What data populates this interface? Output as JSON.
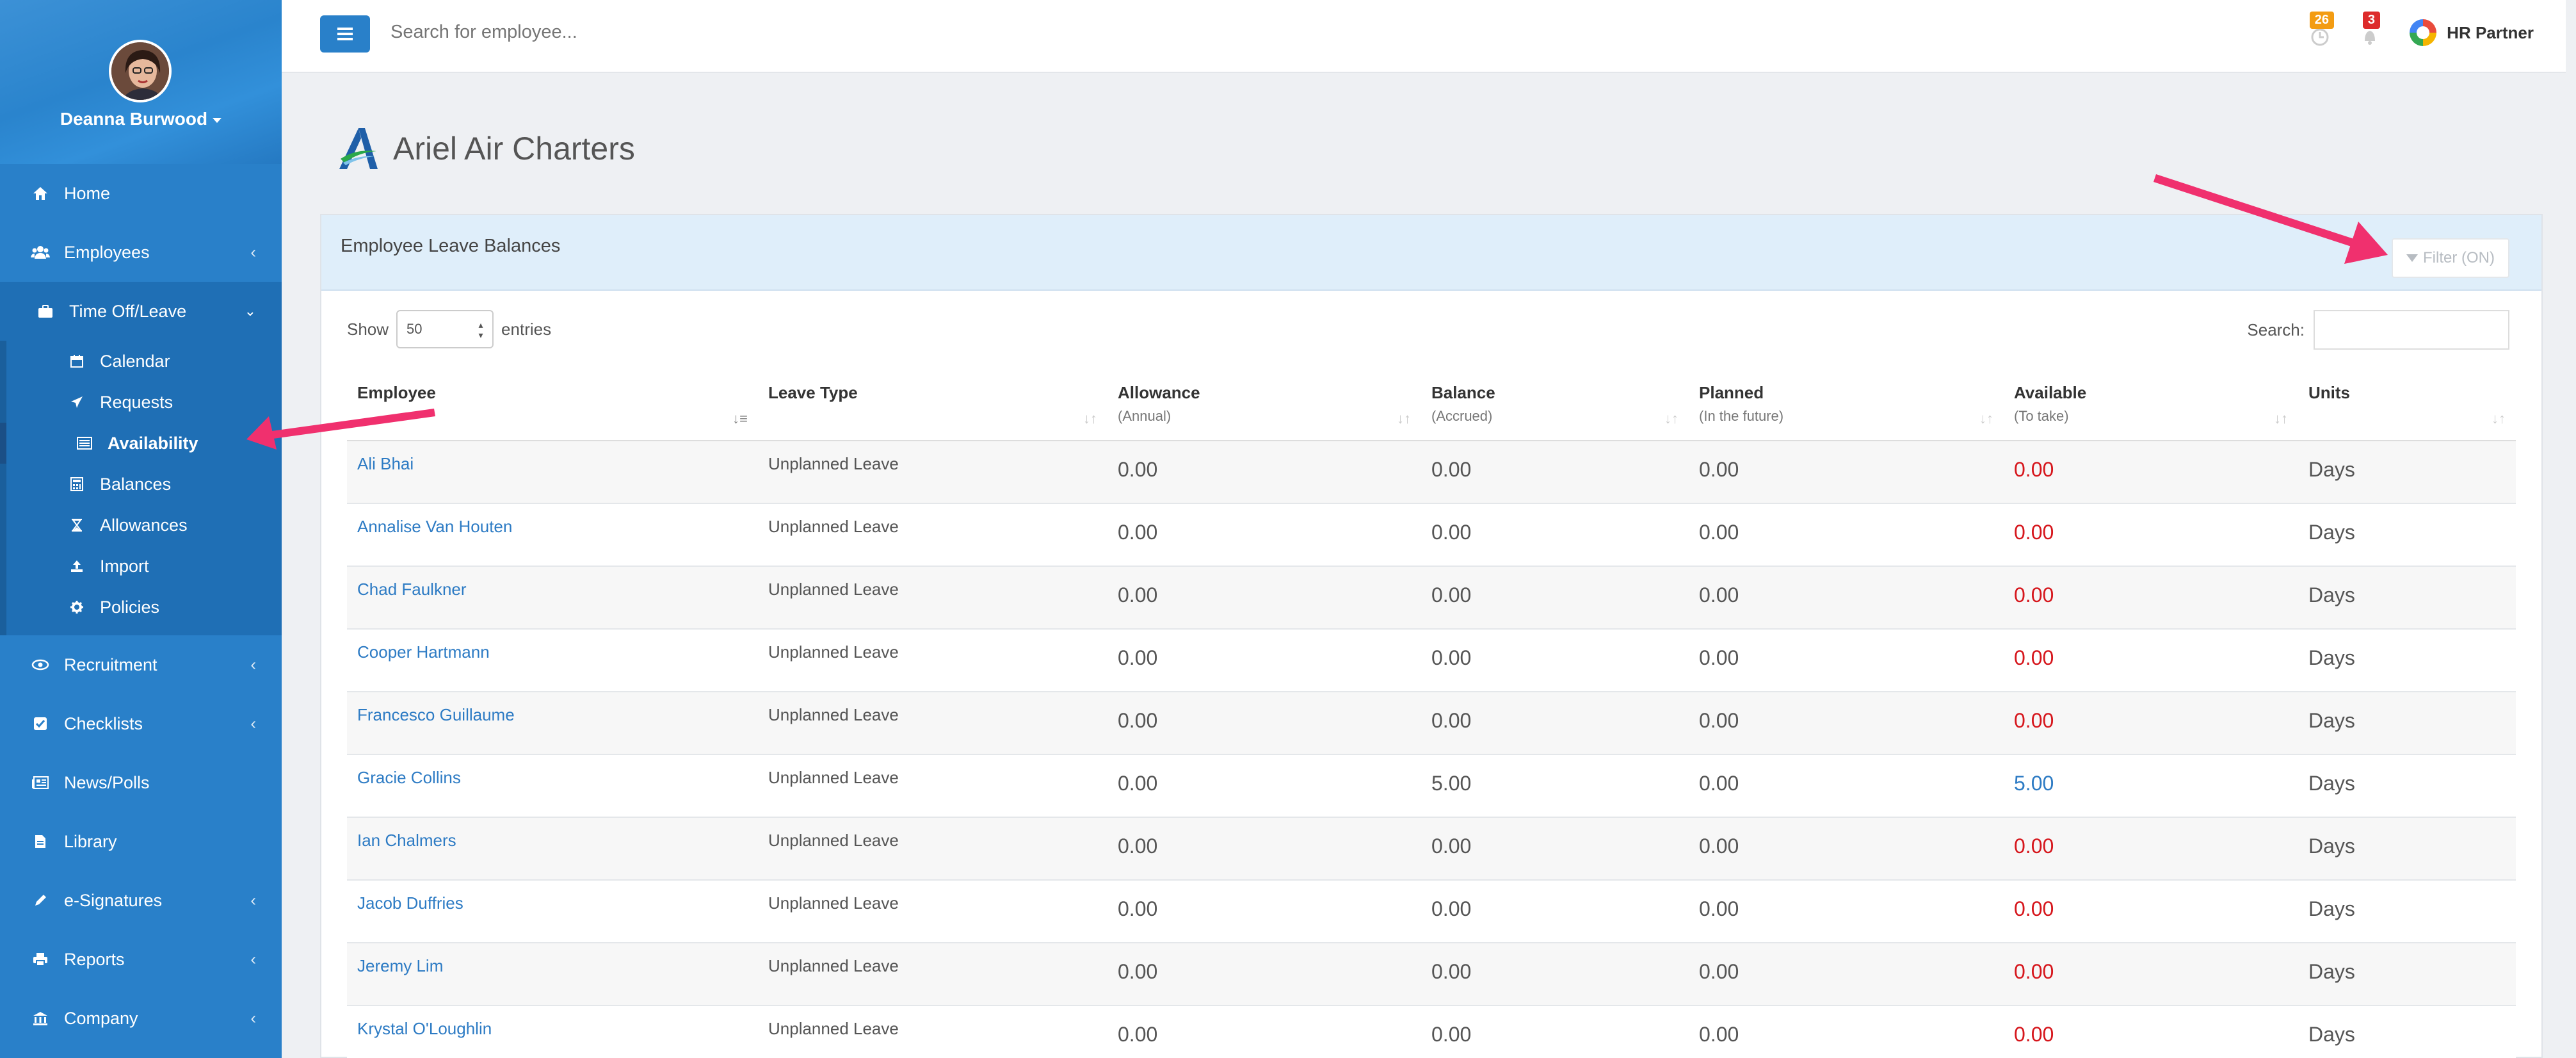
{
  "sidebar": {
    "user_name": "Deanna Burwood",
    "items": [
      {
        "label": "Home",
        "icon": "home-icon"
      },
      {
        "label": "Employees",
        "icon": "users-icon"
      },
      {
        "label": "Time Off/Leave",
        "icon": "briefcase-icon"
      },
      {
        "label": "Recruitment",
        "icon": "eye-icon"
      },
      {
        "label": "Checklists",
        "icon": "checkbox-icon"
      },
      {
        "label": "News/Polls",
        "icon": "newspaper-icon"
      },
      {
        "label": "Library",
        "icon": "file-icon"
      },
      {
        "label": "e-Signatures",
        "icon": "pen-icon"
      },
      {
        "label": "Reports",
        "icon": "print-icon"
      },
      {
        "label": "Company",
        "icon": "bank-icon"
      }
    ],
    "subitems": [
      {
        "label": "Calendar",
        "icon": "calendar-icon"
      },
      {
        "label": "Requests",
        "icon": "plane-icon"
      },
      {
        "label": "Availability",
        "icon": "list-icon"
      },
      {
        "label": "Balances",
        "icon": "calculator-icon"
      },
      {
        "label": "Allowances",
        "icon": "hourglass-icon"
      },
      {
        "label": "Import",
        "icon": "upload-icon"
      },
      {
        "label": "Policies",
        "icon": "gear-icon"
      }
    ]
  },
  "topbar": {
    "search_placeholder": "Search for employee...",
    "badge_tasks": "26",
    "badge_notifications": "3",
    "brand": "HR Partner"
  },
  "company": {
    "name": "Ariel Air Charters"
  },
  "panel": {
    "title": "Employee Leave Balances",
    "filter_label": "Filter (ON)",
    "show_label": "Show",
    "show_value": "50",
    "entries_label": "entries",
    "search_label": "Search:"
  },
  "table": {
    "headers": [
      {
        "label": "Employee",
        "sub": ""
      },
      {
        "label": "Leave Type",
        "sub": ""
      },
      {
        "label": "Allowance",
        "sub": "(Annual)"
      },
      {
        "label": "Balance",
        "sub": "(Accrued)"
      },
      {
        "label": "Planned",
        "sub": "(In the future)"
      },
      {
        "label": "Available",
        "sub": "(To take)"
      },
      {
        "label": "Units",
        "sub": ""
      }
    ],
    "rows": [
      {
        "employee": "Ali Bhai",
        "leave_type": "Unplanned Leave",
        "allowance": "0.00",
        "balance": "0.00",
        "planned": "0.00",
        "available": "0.00",
        "units": "Days"
      },
      {
        "employee": "Annalise Van Houten",
        "leave_type": "Unplanned Leave",
        "allowance": "0.00",
        "balance": "0.00",
        "planned": "0.00",
        "available": "0.00",
        "units": "Days"
      },
      {
        "employee": "Chad Faulkner",
        "leave_type": "Unplanned Leave",
        "allowance": "0.00",
        "balance": "0.00",
        "planned": "0.00",
        "available": "0.00",
        "units": "Days"
      },
      {
        "employee": "Cooper Hartmann",
        "leave_type": "Unplanned Leave",
        "allowance": "0.00",
        "balance": "0.00",
        "planned": "0.00",
        "available": "0.00",
        "units": "Days"
      },
      {
        "employee": "Francesco Guillaume",
        "leave_type": "Unplanned Leave",
        "allowance": "0.00",
        "balance": "0.00",
        "planned": "0.00",
        "available": "0.00",
        "units": "Days"
      },
      {
        "employee": "Gracie Collins",
        "leave_type": "Unplanned Leave",
        "allowance": "0.00",
        "balance": "5.00",
        "planned": "0.00",
        "available": "5.00",
        "units": "Days"
      },
      {
        "employee": "Ian Chalmers",
        "leave_type": "Unplanned Leave",
        "allowance": "0.00",
        "balance": "0.00",
        "planned": "0.00",
        "available": "0.00",
        "units": "Days"
      },
      {
        "employee": "Jacob Duffries",
        "leave_type": "Unplanned Leave",
        "allowance": "0.00",
        "balance": "0.00",
        "planned": "0.00",
        "available": "0.00",
        "units": "Days"
      },
      {
        "employee": "Jeremy Lim",
        "leave_type": "Unplanned Leave",
        "allowance": "0.00",
        "balance": "0.00",
        "planned": "0.00",
        "available": "0.00",
        "units": "Days"
      },
      {
        "employee": "Krystal O'Loughlin",
        "leave_type": "Unplanned Leave",
        "allowance": "0.00",
        "balance": "0.00",
        "planned": "0.00",
        "available": "0.00",
        "units": "Days"
      }
    ]
  },
  "colors": {
    "sidebar": "#2980c9",
    "accent": "#2d7bc4",
    "negative": "#d6161c",
    "annotation_arrow": "#f0306e"
  }
}
